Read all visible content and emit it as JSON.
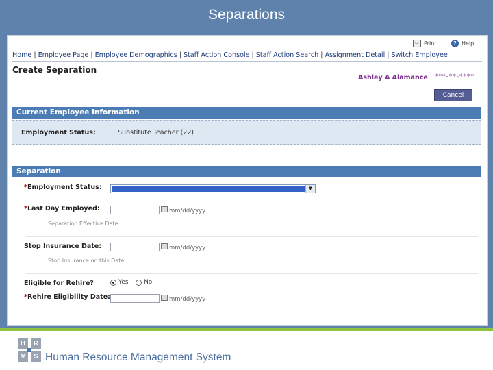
{
  "slide": {
    "title": "Separations",
    "footer_logo_letters": [
      "H",
      "R",
      "M",
      "S"
    ],
    "footer_text": "Human Resource Management System",
    "colors": {
      "background": "#5f82ad",
      "accent_bar": "#8ec43f"
    }
  },
  "utility": {
    "print_label": "Print",
    "help_label": "Help",
    "print_icon": "printer-icon",
    "help_icon": "help-icon"
  },
  "nav": {
    "links": [
      "Home",
      "Employee Page",
      "Employee Demographics",
      "Staff Action Console",
      "Staff Action Search",
      "Assignment Detail",
      "Switch Employee"
    ]
  },
  "page": {
    "title": "Create Separation",
    "employee_name": "Ashley A Alamance",
    "employee_id": "***-**-****",
    "cancel_label": "Cancel"
  },
  "current_info": {
    "header": "Current Employee Information",
    "status_label": "Employment Status:",
    "status_value": "Substitute Teacher (22)"
  },
  "separation": {
    "header": "Separation",
    "employment_status": {
      "label": "Employment Status:",
      "required": "*",
      "value": ""
    },
    "last_day": {
      "label": "Last Day Employed:",
      "required": "*",
      "value": "",
      "format": "mm/dd/yyyy",
      "hint": "Separation Effective Date"
    },
    "stop_insurance": {
      "label": "Stop Insurance Date:",
      "value": "",
      "format": "mm/dd/yyyy",
      "hint": "Stop Insurance on this Date"
    },
    "rehire": {
      "label": "Eligible for Rehire?",
      "yes": "Yes",
      "no": "No",
      "selected": "Yes"
    },
    "rehire_date": {
      "label": "Rehire Eligibility Date:",
      "required": "*",
      "value": "",
      "format": "mm/dd/yyyy"
    }
  }
}
